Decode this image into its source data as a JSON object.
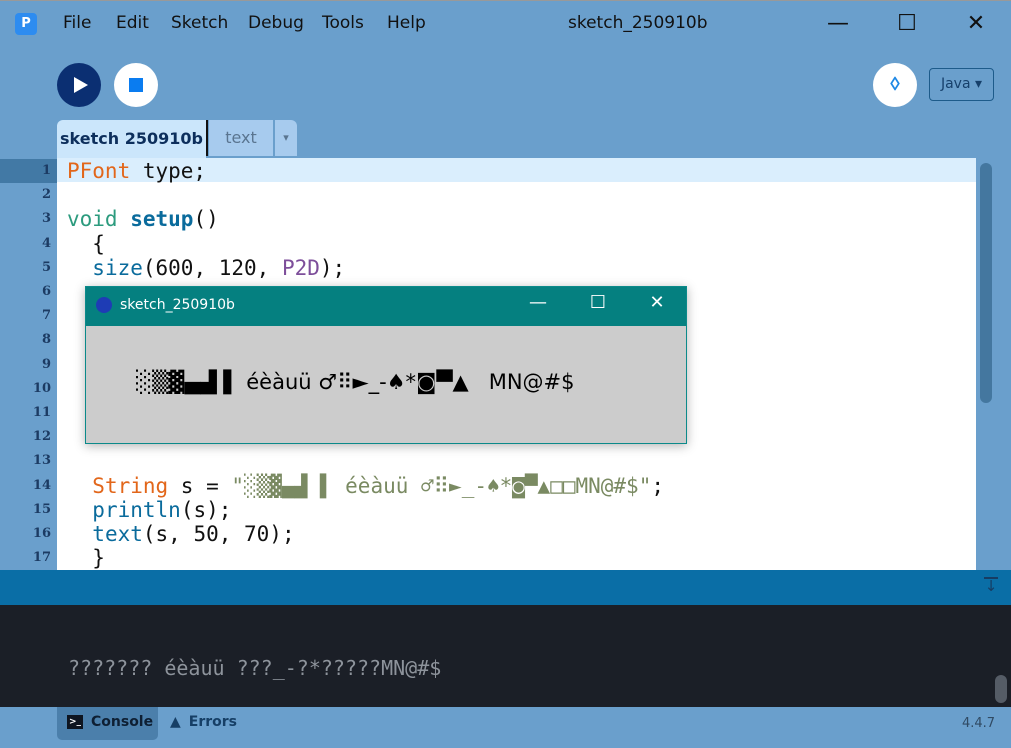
{
  "window": {
    "title": "sketch_250910b",
    "min": "—",
    "max": "☐",
    "close": "✕"
  },
  "menu": [
    "File",
    "Edit",
    "Sketch",
    "Debug",
    "Tools",
    "Help"
  ],
  "toolbar": {
    "debug_glyph": "ꕺ",
    "mode": "Java ▾"
  },
  "tabs": [
    {
      "label": "sketch 250910b"
    },
    {
      "label": "text"
    }
  ],
  "tab_menu": "▾",
  "editor": {
    "lines": [
      {
        "n": "1",
        "toks": [
          [
            "PFont",
            "#e2661a"
          ],
          [
            " type;",
            "#111"
          ]
        ]
      },
      {
        "n": "2",
        "toks": []
      },
      {
        "n": "3",
        "toks": [
          [
            "void",
            "#2c9b7e"
          ],
          [
            " ",
            "#111"
          ],
          [
            "setup",
            "#0a6b9c",
            "b"
          ],
          [
            "()",
            "#111"
          ]
        ]
      },
      {
        "n": "4",
        "toks": [
          [
            "  {",
            "#111"
          ]
        ]
      },
      {
        "n": "5",
        "toks": [
          [
            "  ",
            "#111"
          ],
          [
            "size",
            "#0a6b9c"
          ],
          [
            "(600, 120, ",
            "#111"
          ],
          [
            "P2D",
            "#7d4e9a"
          ],
          [
            ");",
            "#111"
          ]
        ]
      },
      {
        "n": "6",
        "toks": []
      },
      {
        "n": "7",
        "toks": []
      },
      {
        "n": "8",
        "toks": []
      },
      {
        "n": "9",
        "toks": []
      },
      {
        "n": "10",
        "toks": []
      },
      {
        "n": "11",
        "toks": []
      },
      {
        "n": "12",
        "toks": []
      },
      {
        "n": "13",
        "toks": []
      },
      {
        "n": "14",
        "toks": [
          [
            "  ",
            "#111"
          ],
          [
            "String",
            "#e2661a"
          ],
          [
            " s = ",
            "#111"
          ],
          [
            "\"░▒▓▄▟ ▌ éèàuü ♂⠿►_‐♠*◙▀▲□□MN@#$\"",
            "#7a8a62"
          ],
          [
            ";",
            "#111"
          ]
        ]
      },
      {
        "n": "15",
        "toks": [
          [
            "  ",
            "#111"
          ],
          [
            "println",
            "#0a6b9c"
          ],
          [
            "(s);",
            "#111"
          ]
        ]
      },
      {
        "n": "16",
        "toks": [
          [
            "  ",
            "#111"
          ],
          [
            "text",
            "#0a6b9c"
          ],
          [
            "(s, 50, 70);",
            "#111"
          ]
        ]
      },
      {
        "n": "17",
        "toks": [
          [
            "  }",
            "#111"
          ]
        ]
      }
    ]
  },
  "sketch_window": {
    "title": "sketch_250910b",
    "min": "—",
    "max": "☐",
    "close": "✕",
    "output": "░▒▓▄▟ ▌ éèàuü ♂⠿►_‐♠*◙▀▲   MN@#$"
  },
  "console": {
    "output": "??????? éèàuü ???_-?*?????MN@#$",
    "tabs": [
      "Console",
      "Errors"
    ]
  },
  "version": "4.4.7"
}
